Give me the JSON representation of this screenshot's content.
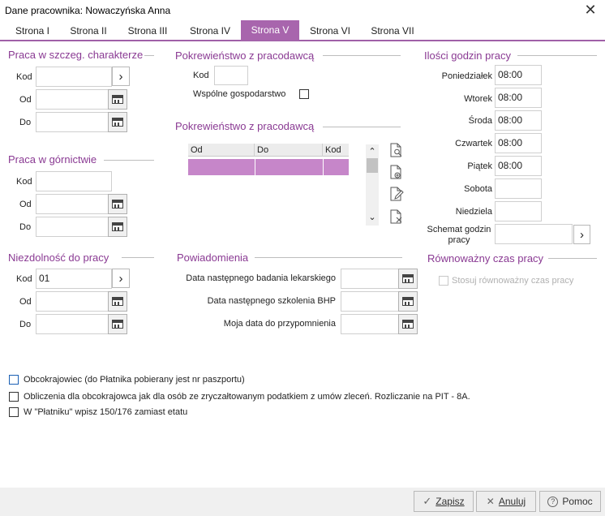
{
  "window": {
    "title": "Dane pracownika: Nowaczyńska Anna",
    "close_glyph": "✕"
  },
  "tabs": [
    {
      "label": "Strona I"
    },
    {
      "label": "Strona II"
    },
    {
      "label": "Strona III"
    },
    {
      "label": "Strona IV"
    },
    {
      "label": "Strona V"
    },
    {
      "label": "Strona VI"
    },
    {
      "label": "Strona VII"
    }
  ],
  "active_tab": "Strona V",
  "sections": {
    "praca_szczeg": {
      "title": "Praca w szczeg. charakterze",
      "kod_label": "Kod",
      "od_label": "Od",
      "do_label": "Do",
      "kod_value": "",
      "od_value": "",
      "do_value": ""
    },
    "praca_gornictwie": {
      "title": "Praca w górnictwie",
      "kod_label": "Kod",
      "od_label": "Od",
      "do_label": "Do",
      "kod_value": "",
      "od_value": "",
      "do_value": ""
    },
    "niezdolnosc": {
      "title": "Niezdolność do pracy",
      "kod_label": "Kod",
      "od_label": "Od",
      "do_label": "Do",
      "kod_value": "01",
      "od_value": "",
      "do_value": ""
    },
    "pokrewienstwo1": {
      "title": "Pokrewieństwo z pracodawcą",
      "kod_label": "Kod",
      "kod_value": "",
      "wspolne_label": "Wspólne gospodarstwo",
      "wspolne_checked": false
    },
    "pokrewienstwo2": {
      "title": "Pokrewieństwo z pracodawcą",
      "columns": [
        "Od",
        "Do",
        "Kod"
      ],
      "rows": [
        [
          "",
          "",
          ""
        ]
      ]
    },
    "powiadomienia": {
      "title": "Powiadomienia",
      "fields": [
        {
          "label": "Data następnego badania lekarskiego",
          "value": ""
        },
        {
          "label": "Data następnego szkolenia BHP",
          "value": ""
        },
        {
          "label": "Moja data do przypomnienia",
          "value": ""
        }
      ]
    },
    "ilosci_godzin": {
      "title": "Ilości godzin pracy",
      "days": [
        {
          "label": "Poniedziałek",
          "value": "08:00"
        },
        {
          "label": "Wtorek",
          "value": "08:00"
        },
        {
          "label": "Środa",
          "value": "08:00"
        },
        {
          "label": "Czwartek",
          "value": "08:00"
        },
        {
          "label": "Piątek",
          "value": "08:00"
        },
        {
          "label": "Sobota",
          "value": ""
        },
        {
          "label": "Niedziela",
          "value": ""
        }
      ],
      "schemat_label_1": "Schemat godzin",
      "schemat_label_2": "pracy",
      "schemat_value": ""
    },
    "rownowazny": {
      "title": "Równoważny czas pracy",
      "checkbox_label": "Stosuj równoważny czas pracy",
      "checked": false,
      "disabled": true
    }
  },
  "checkboxes": [
    {
      "label": "Obcokrajowiec (do Płatnika pobierany jest nr paszportu)",
      "checked": false
    },
    {
      "label": "Obliczenia dla obcokrajowca jak dla osób ze zryczałtowanym podatkiem z umów zleceń. Rozliczanie na PIT - 8A.",
      "checked": false
    },
    {
      "label": "W \"Płatniku\" wpisz 150/176 zamiast etatu",
      "checked": false
    }
  ],
  "footer": {
    "save_label": "Zapisz",
    "cancel_label": "Anuluj",
    "help_label": "Pomoc"
  },
  "colors": {
    "accent": "#a865ad",
    "section_title": "#8a3a93",
    "selected_row": "#c686c9"
  },
  "icons": {
    "arrow": "›",
    "scroll_up": "⌃",
    "scroll_down": "⌄",
    "check": "✓",
    "cross": "✕",
    "help": "?"
  }
}
